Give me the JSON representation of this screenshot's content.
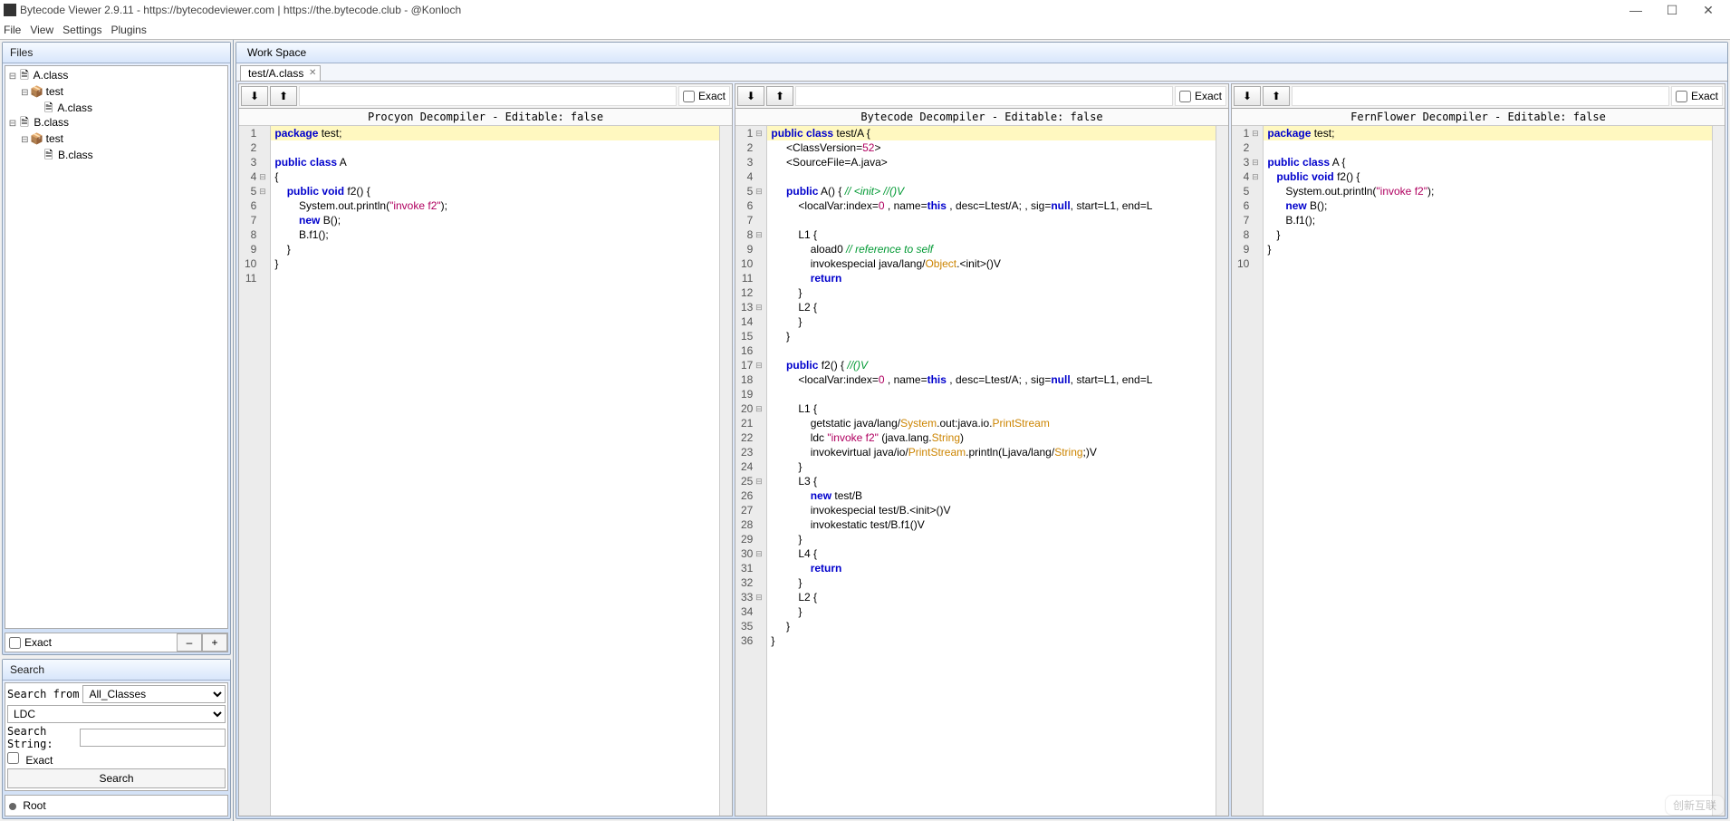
{
  "title": "Bytecode Viewer 2.9.11 - https://bytecodeviewer.com | https://the.bytecode.club - @Konloch",
  "menubar": [
    "File",
    "View",
    "Settings",
    "Plugins"
  ],
  "window_buttons": {
    "min": "—",
    "max": "☐",
    "close": "✕"
  },
  "files_panel": {
    "title": "Files",
    "exact_label": "Exact",
    "minus": "–",
    "plus": "+",
    "tree": [
      {
        "depth": 0,
        "handle": "⊟",
        "icon": "🗎",
        "label": "A.class"
      },
      {
        "depth": 1,
        "handle": "⊟",
        "icon": "📦",
        "label": "test"
      },
      {
        "depth": 2,
        "handle": "",
        "icon": "🗎",
        "label": "A.class"
      },
      {
        "depth": 0,
        "handle": "⊟",
        "icon": "🗎",
        "label": "B.class"
      },
      {
        "depth": 1,
        "handle": "⊟",
        "icon": "📦",
        "label": "test"
      },
      {
        "depth": 2,
        "handle": "",
        "icon": "🗎",
        "label": "B.class"
      }
    ]
  },
  "search_panel": {
    "title": "Search",
    "from_label": "Search from",
    "from_value": "All_Classes",
    "type_value": "LDC",
    "string_label": "Search String:",
    "string_value": "",
    "exact_label": "Exact",
    "button": "Search",
    "root_label": "Root"
  },
  "workspace": {
    "title": "Work Space",
    "tab_label": "test/A.class",
    "exact_label": "Exact",
    "viewers": [
      {
        "header": "Procyon Decompiler - Editable: false",
        "lines": [
          {
            "n": 1,
            "fold": "",
            "hl": true,
            "html": "<span class='kw'>package</span> test;"
          },
          {
            "n": 2,
            "fold": "",
            "html": ""
          },
          {
            "n": 3,
            "fold": "",
            "html": "<span class='kw'>public</span> <span class='kw'>class</span> A"
          },
          {
            "n": 4,
            "fold": "⊟",
            "html": "{"
          },
          {
            "n": 5,
            "fold": "⊟",
            "html": "    <span class='kw'>public</span> <span class='kw'>void</span> f2() {"
          },
          {
            "n": 6,
            "fold": "",
            "html": "        System.out.println(<span class='str'>\"invoke f2\"</span>);"
          },
          {
            "n": 7,
            "fold": "",
            "html": "        <span class='kw'>new</span> B();"
          },
          {
            "n": 8,
            "fold": "",
            "html": "        B.f1();"
          },
          {
            "n": 9,
            "fold": "",
            "html": "    }"
          },
          {
            "n": 10,
            "fold": "",
            "html": "}"
          },
          {
            "n": 11,
            "fold": "",
            "html": ""
          }
        ]
      },
      {
        "header": "Bytecode Decompiler - Editable: false",
        "lines": [
          {
            "n": 1,
            "fold": "⊟",
            "hl": true,
            "html": "<span class='kw'>public</span> <span class='kw'>class</span> test/A {"
          },
          {
            "n": 2,
            "fold": "",
            "html": "     &lt;ClassVersion=<span class='num'>52</span>&gt;"
          },
          {
            "n": 3,
            "fold": "",
            "html": "     &lt;SourceFile=A.java&gt;"
          },
          {
            "n": 4,
            "fold": "",
            "html": ""
          },
          {
            "n": 5,
            "fold": "⊟",
            "html": "     <span class='kw'>public</span> A() { <span class='cm'>// &lt;init&gt; //()V</span>"
          },
          {
            "n": 6,
            "fold": "",
            "html": "         &lt;localVar:index=<span class='num'>0</span> , name=<span class='kw'>this</span> , desc=Ltest/A; , sig=<span class='kw'>null</span>, start=L1, end=L"
          },
          {
            "n": 7,
            "fold": "",
            "html": ""
          },
          {
            "n": 8,
            "fold": "⊟",
            "html": "         L1 {"
          },
          {
            "n": 9,
            "fold": "",
            "html": "             aload0 <span class='cm'>// reference to self</span>"
          },
          {
            "n": 10,
            "fold": "",
            "html": "             invokespecial java/lang/<span class='cls'>Object</span>.&lt;init&gt;()V"
          },
          {
            "n": 11,
            "fold": "",
            "html": "             <span class='kw'>return</span>"
          },
          {
            "n": 12,
            "fold": "",
            "html": "         }"
          },
          {
            "n": 13,
            "fold": "⊟",
            "html": "         L2 {"
          },
          {
            "n": 14,
            "fold": "",
            "html": "         }"
          },
          {
            "n": 15,
            "fold": "",
            "html": "     }"
          },
          {
            "n": 16,
            "fold": "",
            "html": ""
          },
          {
            "n": 17,
            "fold": "⊟",
            "html": "     <span class='kw'>public</span> f2() { <span class='cm'>//()V</span>"
          },
          {
            "n": 18,
            "fold": "",
            "html": "         &lt;localVar:index=<span class='num'>0</span> , name=<span class='kw'>this</span> , desc=Ltest/A; , sig=<span class='kw'>null</span>, start=L1, end=L"
          },
          {
            "n": 19,
            "fold": "",
            "html": ""
          },
          {
            "n": 20,
            "fold": "⊟",
            "html": "         L1 {"
          },
          {
            "n": 21,
            "fold": "",
            "html": "             getstatic java/lang/<span class='cls'>System</span>.out:java.io.<span class='cls'>PrintStream</span>"
          },
          {
            "n": 22,
            "fold": "",
            "html": "             ldc <span class='str'>\"invoke f2\"</span> (java.lang.<span class='cls'>String</span>)"
          },
          {
            "n": 23,
            "fold": "",
            "html": "             invokevirtual java/io/<span class='cls'>PrintStream</span>.println(Ljava/lang/<span class='cls'>String</span>;)V"
          },
          {
            "n": 24,
            "fold": "",
            "html": "         }"
          },
          {
            "n": 25,
            "fold": "⊟",
            "html": "         L3 {"
          },
          {
            "n": 26,
            "fold": "",
            "html": "             <span class='kw'>new</span> test/B"
          },
          {
            "n": 27,
            "fold": "",
            "html": "             invokespecial test/B.&lt;init&gt;()V"
          },
          {
            "n": 28,
            "fold": "",
            "html": "             invokestatic test/B.f1()V"
          },
          {
            "n": 29,
            "fold": "",
            "html": "         }"
          },
          {
            "n": 30,
            "fold": "⊟",
            "html": "         L4 {"
          },
          {
            "n": 31,
            "fold": "",
            "html": "             <span class='kw'>return</span>"
          },
          {
            "n": 32,
            "fold": "",
            "html": "         }"
          },
          {
            "n": 33,
            "fold": "⊟",
            "html": "         L2 {"
          },
          {
            "n": 34,
            "fold": "",
            "html": "         }"
          },
          {
            "n": 35,
            "fold": "",
            "html": "     }"
          },
          {
            "n": 36,
            "fold": "",
            "html": "}"
          }
        ]
      },
      {
        "header": "FernFlower Decompiler - Editable: false",
        "lines": [
          {
            "n": 1,
            "fold": "⊟",
            "hl": true,
            "html": "<span class='kw'>package</span> test;"
          },
          {
            "n": 2,
            "fold": "",
            "html": ""
          },
          {
            "n": 3,
            "fold": "⊟",
            "html": "<span class='kw'>public</span> <span class='kw'>class</span> A {"
          },
          {
            "n": 4,
            "fold": "⊟",
            "html": "   <span class='kw'>public</span> <span class='kw'>void</span> f2() {"
          },
          {
            "n": 5,
            "fold": "",
            "html": "      System.out.println(<span class='str'>\"invoke f2\"</span>);"
          },
          {
            "n": 6,
            "fold": "",
            "html": "      <span class='kw'>new</span> B();"
          },
          {
            "n": 7,
            "fold": "",
            "html": "      B.f1();"
          },
          {
            "n": 8,
            "fold": "",
            "html": "   }"
          },
          {
            "n": 9,
            "fold": "",
            "html": "}"
          },
          {
            "n": 10,
            "fold": "",
            "html": ""
          }
        ]
      }
    ]
  },
  "watermark": "创新互联"
}
